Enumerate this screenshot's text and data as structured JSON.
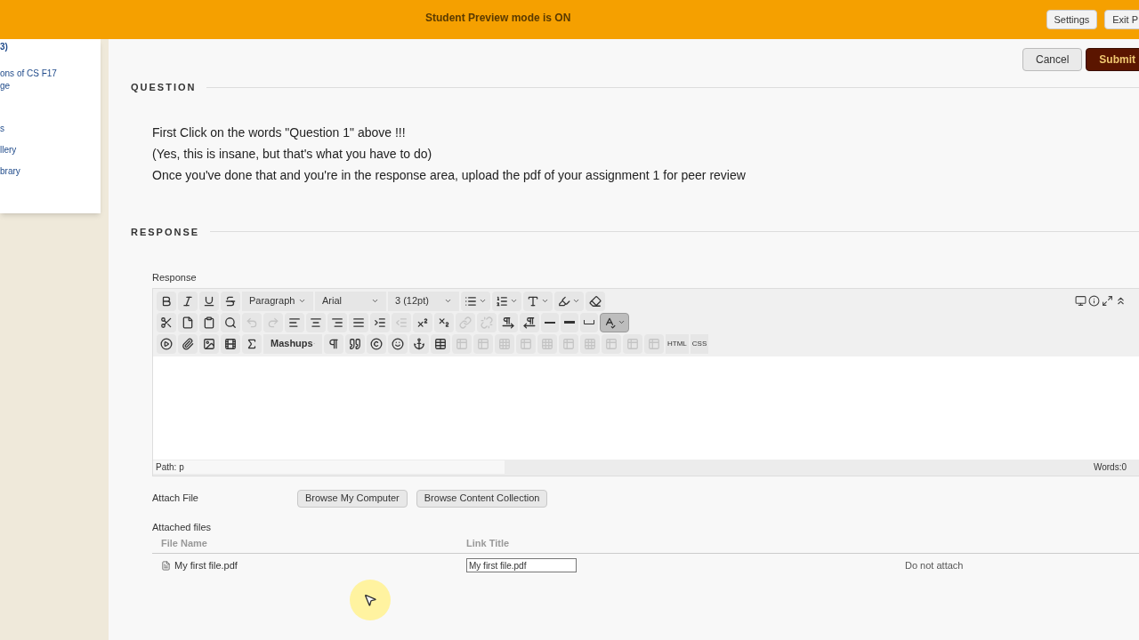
{
  "preview_bar": {
    "message": "Student Preview mode is ON",
    "buttons": [
      "Settings",
      "Exit P"
    ]
  },
  "sidebar": {
    "items": [
      "3)",
      "ons of CS F17",
      "ge",
      "s",
      "llery",
      "brary"
    ]
  },
  "actions": [
    {
      "label": "Cancel",
      "kind": "secondary"
    },
    {
      "label": "Submit",
      "kind": "primary"
    }
  ],
  "question": {
    "heading": "QUESTION",
    "lines": [
      "First Click on the words \"Question 1\" above !!!",
      "(Yes, this is insane, but that's what you have to do)",
      "Once you've done that and you're in the response area, upload the pdf of your assignment 1 for peer review"
    ]
  },
  "response": {
    "heading": "RESPONSE",
    "label": "Response",
    "toolbar_rows": [
      [
        {
          "kind": "icon",
          "disabled": false
        },
        {
          "kind": "icon",
          "disabled": false
        },
        {
          "kind": "icon",
          "disabled": false
        },
        {
          "kind": "icon",
          "disabled": false
        },
        {
          "kind": "dropdown",
          "label": "Paragraph"
        },
        {
          "kind": "dropdown",
          "label": "Arial"
        },
        {
          "kind": "dropdown",
          "label": "3 (12pt)"
        },
        {
          "kind": "split",
          "disabled": false
        },
        {
          "kind": "split",
          "disabled": false
        },
        {
          "kind": "split",
          "disabled": false
        },
        {
          "kind": "split",
          "disabled": false
        },
        {
          "kind": "icon",
          "disabled": false
        }
      ],
      [
        {
          "kind": "icon",
          "disabled": false
        },
        {
          "kind": "icon",
          "disabled": false
        },
        {
          "kind": "icon",
          "disabled": false
        },
        {
          "kind": "icon",
          "disabled": false
        },
        {
          "kind": "icon",
          "disabled": true
        },
        {
          "kind": "icon",
          "disabled": true
        },
        {
          "kind": "icon",
          "disabled": false
        },
        {
          "kind": "icon",
          "disabled": false
        },
        {
          "kind": "icon",
          "disabled": false
        },
        {
          "kind": "icon",
          "disabled": false
        },
        {
          "kind": "icon",
          "disabled": false
        },
        {
          "kind": "icon",
          "disabled": true
        },
        {
          "kind": "icon",
          "disabled": false
        },
        {
          "kind": "icon",
          "disabled": false
        },
        {
          "kind": "icon",
          "disabled": true
        },
        {
          "kind": "icon",
          "disabled": true
        },
        {
          "kind": "icon",
          "disabled": false
        },
        {
          "kind": "icon",
          "disabled": false
        },
        {
          "kind": "icon",
          "disabled": false
        },
        {
          "kind": "icon",
          "disabled": false
        },
        {
          "kind": "icon",
          "disabled": false
        },
        {
          "kind": "split",
          "disabled": false,
          "selected": true
        }
      ],
      [
        {
          "kind": "icon",
          "disabled": false
        },
        {
          "kind": "icon",
          "disabled": false
        },
        {
          "kind": "icon",
          "disabled": false
        },
        {
          "kind": "icon",
          "disabled": false
        },
        {
          "kind": "icon",
          "disabled": false
        },
        {
          "kind": "dropdown",
          "label": "Mashups"
        },
        {
          "kind": "icon",
          "disabled": false
        },
        {
          "kind": "icon",
          "disabled": false
        },
        {
          "kind": "icon",
          "disabled": false
        },
        {
          "kind": "icon",
          "disabled": false
        },
        {
          "kind": "icon",
          "disabled": false
        },
        {
          "kind": "icon",
          "disabled": false
        },
        {
          "kind": "icon",
          "disabled": true
        },
        {
          "kind": "icon",
          "disabled": true
        },
        {
          "kind": "icon",
          "disabled": true
        },
        {
          "kind": "icon",
          "disabled": true
        },
        {
          "kind": "icon",
          "disabled": true
        },
        {
          "kind": "icon",
          "disabled": true
        },
        {
          "kind": "icon",
          "disabled": true
        },
        {
          "kind": "icon",
          "disabled": true
        },
        {
          "kind": "icon",
          "disabled": true
        },
        {
          "kind": "icon",
          "disabled": true
        },
        {
          "kind": "text",
          "label": "HTML"
        },
        {
          "kind": "text",
          "label": "CSS"
        }
      ]
    ],
    "path": "Path: p",
    "words": "Words:0"
  },
  "attach": {
    "label": "Attach File",
    "buttons": [
      "Browse My Computer",
      "Browse Content Collection"
    ],
    "attached_label": "Attached files",
    "columns": [
      "File Name",
      "Link Title"
    ],
    "files": [
      {
        "name": "My first file.pdf",
        "link_title": "My first file.pdf",
        "action": "Do not attach"
      }
    ]
  }
}
